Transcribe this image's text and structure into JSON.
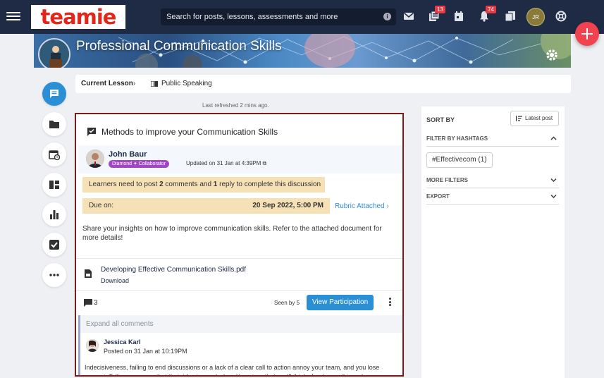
{
  "app": {
    "logo_text": "teamie",
    "search_placeholder": "Search for posts, lessons, assessments and more",
    "badges": {
      "feed": "13",
      "notifications": "74"
    },
    "user_initials": "JR"
  },
  "banner": {
    "title": "Professional Communication Skills"
  },
  "lesson_bar": {
    "current_label": "Current Lesson",
    "lesson_name": "Public Speaking"
  },
  "refreshed": "Last refreshed 2 mins ago.",
  "post": {
    "title": "Methods to improve your Communication Skills",
    "author": "John Baur",
    "role": "Diamond ✦ Collaborator",
    "updated": "Updated on 31 Jan at 4:39PM",
    "requirement_parts": {
      "a": "Learners need to post ",
      "b": "2",
      "c": " comments and ",
      "d": "1",
      "e": " reply to complete this discussion"
    },
    "due_label": "Due on:",
    "due_value": "20 Sep 2022, 5:00 PM",
    "rubric": "Rubric Attached",
    "description": "Share your insights on how to improve communication skills. Refer to the attached document for more details!",
    "attachment_name": "Developing Effective Communication Skills.pdf",
    "attachment_action": "Download",
    "comment_count": "3",
    "seen_by": "Seen by 5",
    "view_participation": "View Participation",
    "expand_comments": "Expand all comments",
    "comment": {
      "author": "Jessica Karl",
      "time": "Posted on 31 Jan at 10:19PM",
      "body": "Indecisiveness, failing to end discussions or a lack of a clear call to action annoy your team, and you lose respect. Telling someone that their idea is good when it's not, or that you'll think about something when"
    }
  },
  "panel": {
    "sort_by": "SORT BY",
    "latest_post": "Latest post",
    "filter_hashtags": "FILTER BY HASHTAGS",
    "hashtag": "#Effectivecom (1)",
    "more_filters": "MORE FILTERS",
    "export": "EXPORT"
  },
  "colors": {
    "topbar": "#1f2a44",
    "accent": "#2b8fd6",
    "alert": "#f6e0b6",
    "fab": "#f0424f",
    "post_border": "#7a1c1c"
  }
}
